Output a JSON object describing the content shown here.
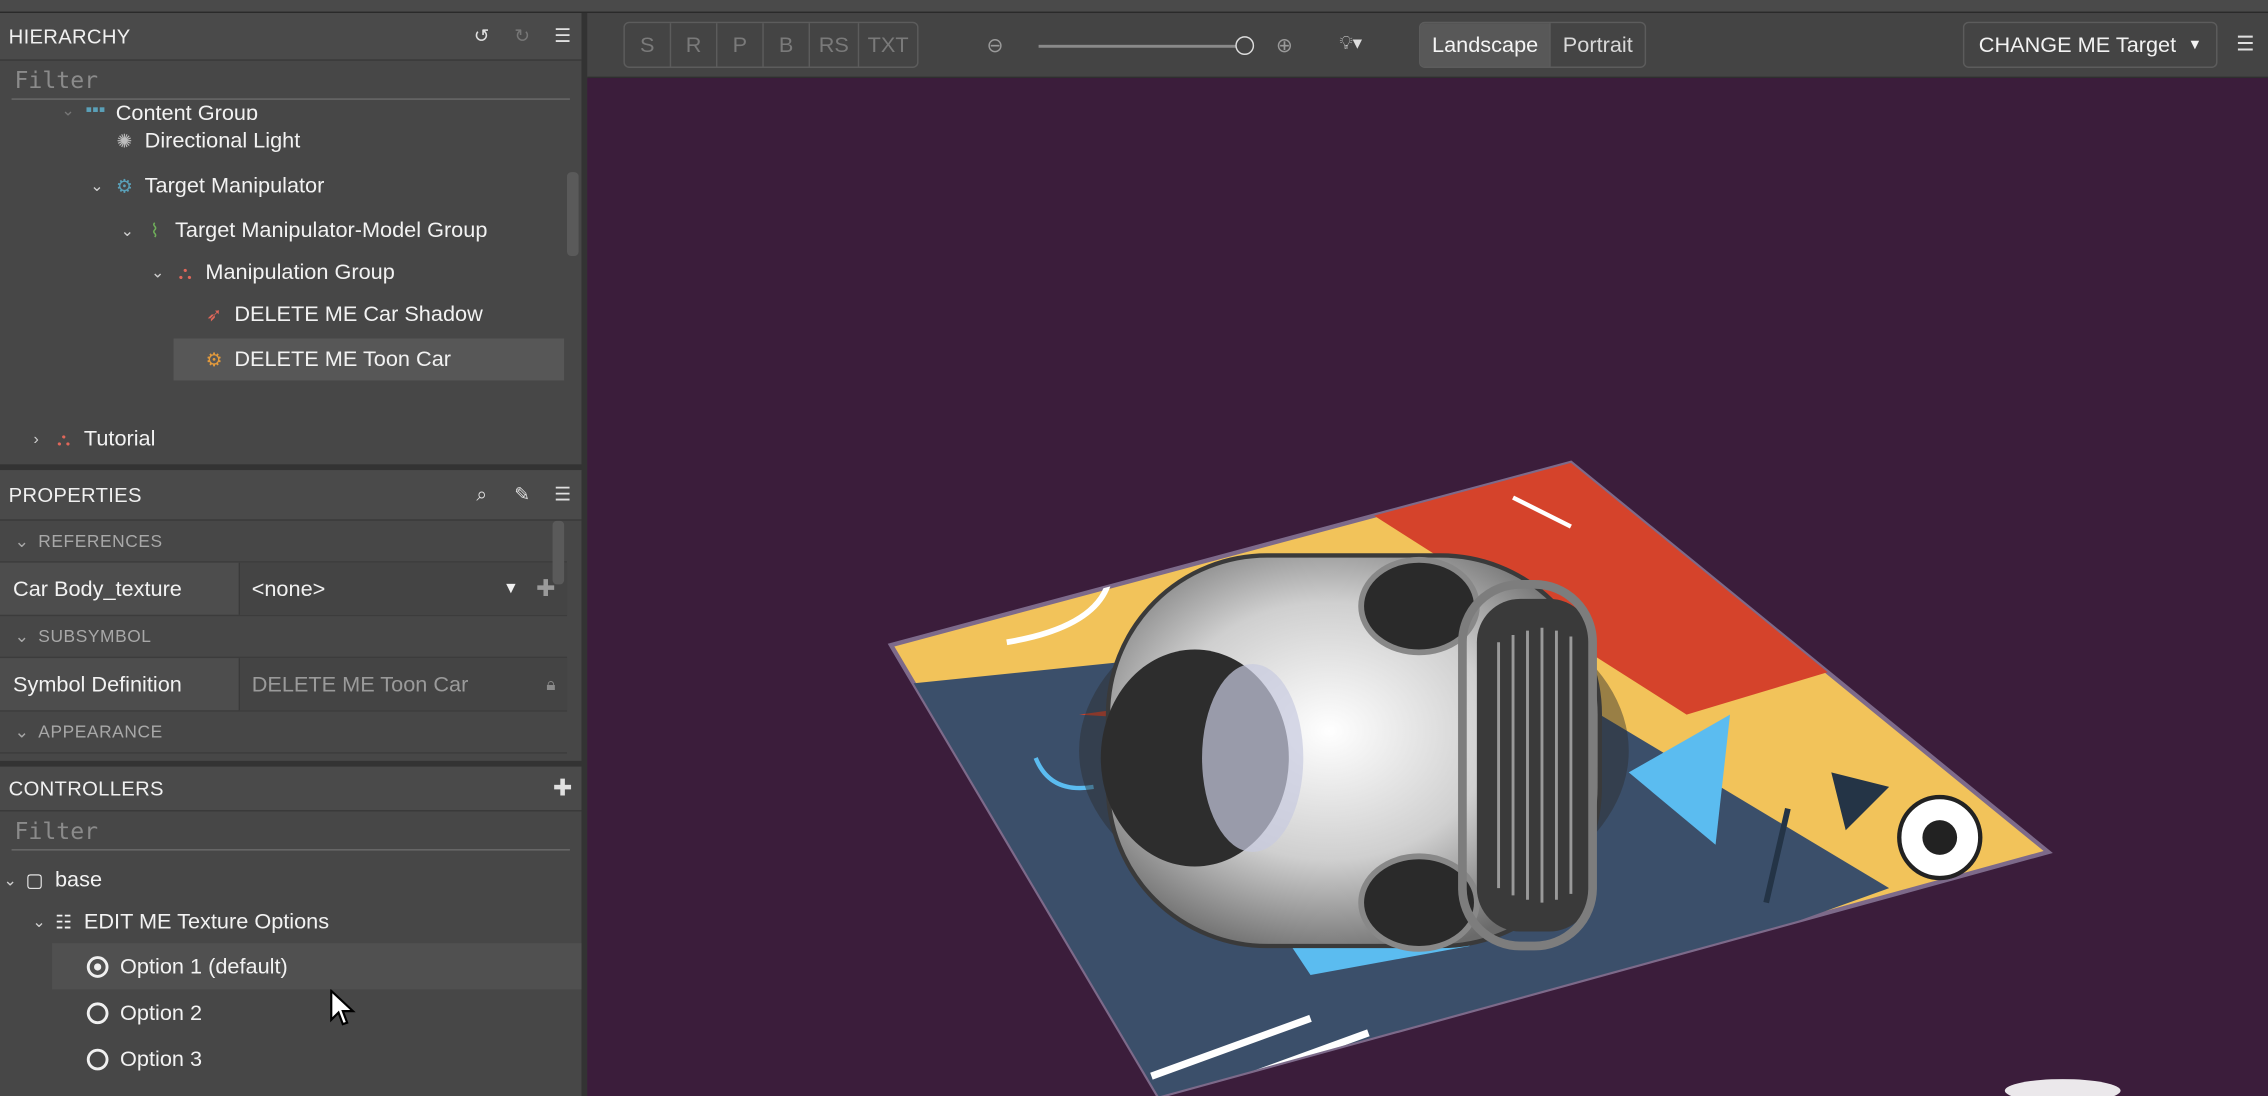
{
  "hierarchy": {
    "title": "HIERARCHY",
    "filter_placeholder": "Filter",
    "items": [
      {
        "label": "Content Group"
      },
      {
        "label": "Directional Light"
      },
      {
        "label": "Target Manipulator"
      },
      {
        "label": "Target Manipulator-Model Group"
      },
      {
        "label": "Manipulation Group"
      },
      {
        "label": "DELETE ME Car Shadow"
      },
      {
        "label": "DELETE ME Toon Car"
      },
      {
        "label": "Tutorial"
      }
    ]
  },
  "properties": {
    "title": "PROPERTIES",
    "sections": {
      "references": "REFERENCES",
      "subsymbol": "SUBSYMBOL",
      "appearance": "APPEARANCE"
    },
    "car_body_texture": {
      "label": "Car Body_texture",
      "value": "<none>"
    },
    "symbol_definition": {
      "label": "Symbol Definition",
      "value": "DELETE ME Toon Car"
    }
  },
  "controllers": {
    "title": "CONTROLLERS",
    "filter_placeholder": "Filter",
    "base": "base",
    "texture_options": "EDIT ME Texture Options",
    "options": [
      {
        "label": "Option 1 (default)",
        "selected": true
      },
      {
        "label": "Option 2",
        "selected": false
      },
      {
        "label": "Option 3",
        "selected": false
      }
    ]
  },
  "toolbar": {
    "segments": [
      "S",
      "R",
      "P",
      "B",
      "RS",
      "TXT"
    ],
    "zoom_level": 1.0,
    "orientation": {
      "landscape": "Landscape",
      "portrait": "Portrait",
      "active": "Landscape"
    },
    "target_label": "CHANGE ME Target"
  },
  "colors": {
    "viewport_bg": "#3b1d3b",
    "panel_bg": "#474747",
    "hierarchy_icon_group": "#5aa0b8",
    "hierarchy_icon_red": "#e0675a",
    "hierarchy_icon_orange": "#e39a3c",
    "hierarchy_icon_green": "#6fae5a"
  }
}
